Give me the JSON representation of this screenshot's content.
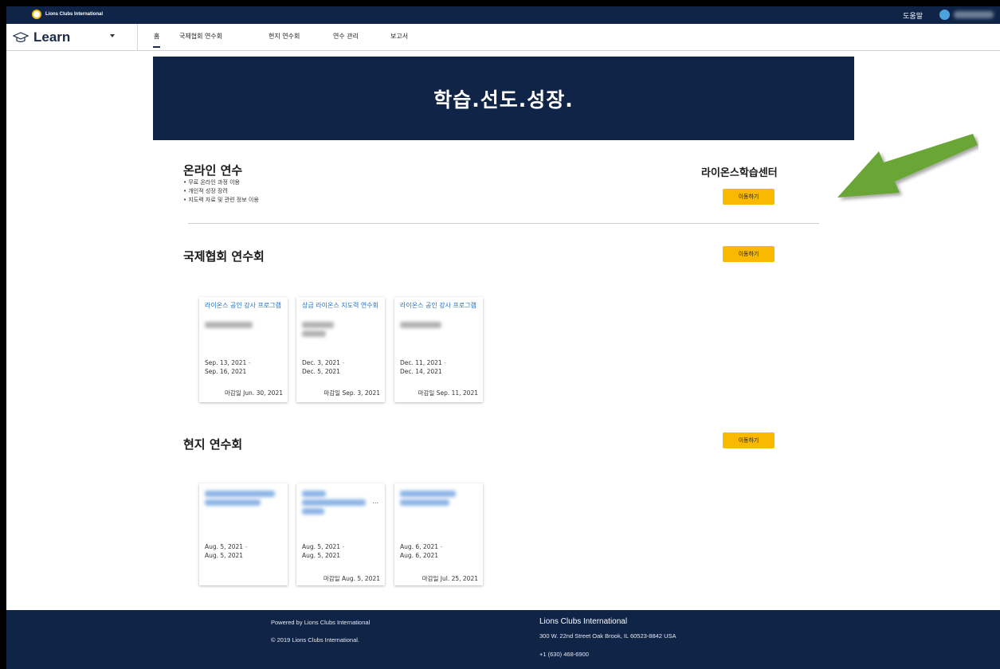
{
  "topbar": {
    "brand": "Lions Clubs International",
    "help": "도움말"
  },
  "nav": {
    "app_name": "Learn",
    "tabs": [
      "홈",
      "국제협회 연수회",
      "현지 연수회",
      "연수 관리",
      "보고서"
    ]
  },
  "hero": {
    "title": "학습.선도.성장."
  },
  "online": {
    "title": "온라인 연수",
    "bullets": [
      "무료 온라인 과정 이용",
      "개인적 성장 장려",
      "지도력 자료 및 관련 정보 이용"
    ],
    "lc_title": "라이온스학습센터",
    "button": "이동하기"
  },
  "intl": {
    "title": "국제협회 연수회",
    "button": "이동하기",
    "cards": [
      {
        "title": "라이온스 공인 강사 프로그램",
        "date_start": "Sep. 13, 2021",
        "date_end": "Sep. 16, 2021",
        "deadline_label": "마감일",
        "deadline": "Jun. 30, 2021"
      },
      {
        "title": "상급 라이온스 지도력 연수회",
        "date_start": "Dec. 3, 2021",
        "date_end": "Dec. 5, 2021",
        "deadline_label": "마감일",
        "deadline": "Sep. 3, 2021"
      },
      {
        "title": "라이온스 공인 강사 프로그램",
        "date_start": "Dec. 11, 2021",
        "date_end": "Dec. 14, 2021",
        "deadline_label": "마감일",
        "deadline": "Sep. 11, 2021"
      }
    ]
  },
  "local": {
    "title": "현지 연수회",
    "button": "이동하기",
    "cards": [
      {
        "date_start": "Aug. 5, 2021",
        "date_end": "Aug. 5, 2021",
        "deadline_label": "",
        "deadline": ""
      },
      {
        "date_start": "Aug. 5, 2021",
        "date_end": "Aug. 5, 2021",
        "deadline_label": "마감일",
        "deadline": "Aug. 5, 2021",
        "more": "..."
      },
      {
        "date_start": "Aug. 6, 2021",
        "date_end": "Aug. 6, 2021",
        "deadline_label": "마감일",
        "deadline": "Jul. 25, 2021"
      }
    ]
  },
  "footer": {
    "powered": "Powered by Lions Clubs International",
    "copyright": "© 2019 Lions Clubs International.",
    "org": "Lions Clubs International",
    "address": "300 W. 22nd Street Oak Brook, IL 60523-8842 USA",
    "phone": "+1 (630) 468-6900"
  },
  "colors": {
    "navy": "#0f2447",
    "accent": "#f9b900",
    "link": "#1f6fc9",
    "arrow": "#6aa636"
  }
}
